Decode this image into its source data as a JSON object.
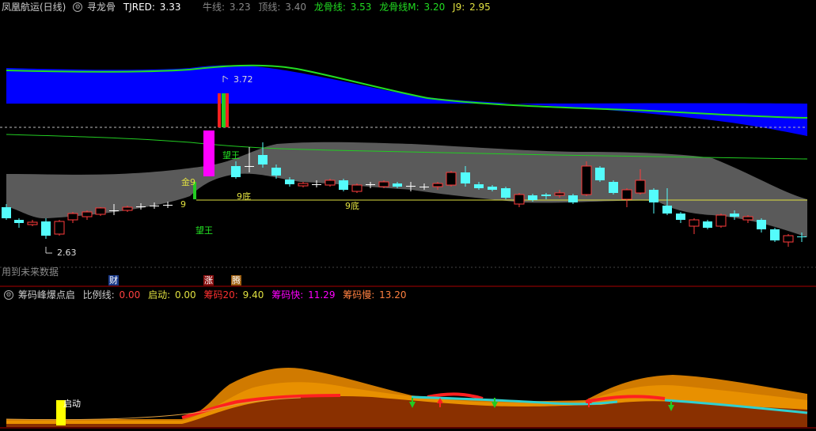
{
  "top_header": {
    "title": "凤凰航运(日线)",
    "indicator": "寻龙骨",
    "tjred_label": "TJRED:",
    "tjred_value": "3.33",
    "niu_label": "牛线:",
    "niu_value": "3.23",
    "ding_label": "顶线:",
    "ding_value": "3.40",
    "longgu_label": "龙骨线:",
    "longgu_value": "3.53",
    "longgum_label": "龙骨线M:",
    "longgum_value": "3.20",
    "j9_label": "J9:",
    "j9_value": "2.95"
  },
  "price_labels": {
    "high": "3.72",
    "low": "2.63"
  },
  "chart_labels": {
    "jin9": "金9",
    "nine": "9",
    "wangwang_top": "望王",
    "wangwang_bottom": "望王",
    "nine_bottom_1": "9底",
    "nine_bottom_2": "9底"
  },
  "note": "用到未来数据",
  "tags": {
    "cai": "财",
    "zhang": "涨",
    "teng": "腾"
  },
  "bottom_header": {
    "title": "筹码峰爆点启",
    "ratio_label": "比例线:",
    "ratio_value": "0.00",
    "start_label": "启动:",
    "start_value": "0.00",
    "chip20_label": "筹码20:",
    "chip20_value": "9.40",
    "fast_label": "筹码快:",
    "fast_value": "11.29",
    "slow_label": "筹码慢:",
    "slow_value": "13.20"
  },
  "start_label": "启动",
  "colors": {
    "up": "#ff3b3b",
    "down": "#54fcfc",
    "doji": "#ffffff",
    "blue_band": "#0000ff",
    "gray_band": "#5a5a5a",
    "green_line": "#22dd22",
    "yellow_line": "#e0e040",
    "magenta": "#ff00ff"
  }
}
